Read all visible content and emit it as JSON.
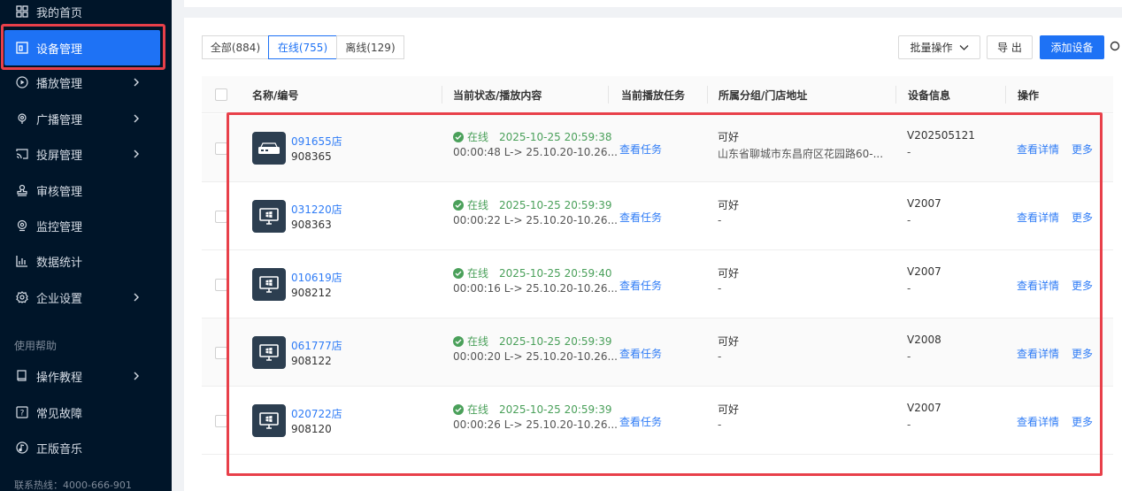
{
  "sidebar": {
    "items": [
      {
        "label": "我的首页",
        "icon": "grid-icon"
      },
      {
        "label": "设备管理",
        "icon": "device-icon"
      },
      {
        "label": "播放管理",
        "icon": "play-icon"
      },
      {
        "label": "广播管理",
        "icon": "broadcast-icon"
      },
      {
        "label": "投屏管理",
        "icon": "cast-icon"
      },
      {
        "label": "审核管理",
        "icon": "stamp-icon"
      },
      {
        "label": "监控管理",
        "icon": "camera-icon"
      },
      {
        "label": "数据统计",
        "icon": "chart-icon"
      },
      {
        "label": "企业设置",
        "icon": "gear-icon"
      }
    ],
    "help_section": "使用帮助",
    "help_items": [
      {
        "label": "操作教程",
        "icon": "book-icon"
      },
      {
        "label": "常见故障",
        "icon": "question-icon"
      },
      {
        "label": "正版音乐",
        "icon": "music-icon"
      }
    ],
    "hotline": "联系热线：4000-666-901"
  },
  "tabs": [
    {
      "label": "全部(884)"
    },
    {
      "label": "在线(755)"
    },
    {
      "label": "离线(129)"
    }
  ],
  "toolbar": {
    "batch": "批量操作",
    "export": "导 出",
    "add": "添加设备"
  },
  "table": {
    "headers": [
      "名称/编号",
      "当前状态/播放内容",
      "当前播放任务",
      "所属分组/门店地址",
      "设备信息",
      "操作"
    ],
    "rows": [
      {
        "name": "091655店",
        "code": "908365",
        "status": "在线",
        "time": "2025-10-25 20:59:38",
        "play": "00:00:48 L-> 25.10.20-10.26...",
        "task": "查看任务",
        "group": "可好",
        "addr": "山东省聊城市东昌府区花园路60-...",
        "ver": "V202505121",
        "ver2": "-",
        "op1": "查看详情",
        "op2": "更多",
        "icon": "box-device-icon"
      },
      {
        "name": "031220店",
        "code": "908363",
        "status": "在线",
        "time": "2025-10-25 20:59:39",
        "play": "00:00:22 L-> 25.10.20-10.26...",
        "task": "查看任务",
        "group": "可好",
        "addr": "-",
        "ver": "V2007",
        "ver2": "-",
        "op1": "查看详情",
        "op2": "更多",
        "icon": "windows-monitor-icon"
      },
      {
        "name": "010619店",
        "code": "908212",
        "status": "在线",
        "time": "2025-10-25 20:59:40",
        "play": "00:00:16 L-> 25.10.20-10.26...",
        "task": "查看任务",
        "group": "可好",
        "addr": "-",
        "ver": "V2007",
        "ver2": "-",
        "op1": "查看详情",
        "op2": "更多",
        "icon": "windows-monitor-icon"
      },
      {
        "name": "061777店",
        "code": "908122",
        "status": "在线",
        "time": "2025-10-25 20:59:39",
        "play": "00:00:20 L-> 25.10.20-10.26...",
        "task": "查看任务",
        "group": "可好",
        "addr": "-",
        "ver": "V2008",
        "ver2": "-",
        "op1": "查看详情",
        "op2": "更多",
        "icon": "windows-monitor-icon"
      },
      {
        "name": "020722店",
        "code": "908120",
        "status": "在线",
        "time": "2025-10-25 20:59:39",
        "play": "00:00:26 L-> 25.10.20-10.26...",
        "task": "查看任务",
        "group": "可好",
        "addr": "-",
        "ver": "V2007",
        "ver2": "-",
        "op1": "查看详情",
        "op2": "更多",
        "icon": "windows-monitor-icon"
      }
    ]
  },
  "colors": {
    "accent": "#1e72f5",
    "online": "#4aa05a",
    "highlight": "#e8404a",
    "sidebar": "#001529"
  }
}
